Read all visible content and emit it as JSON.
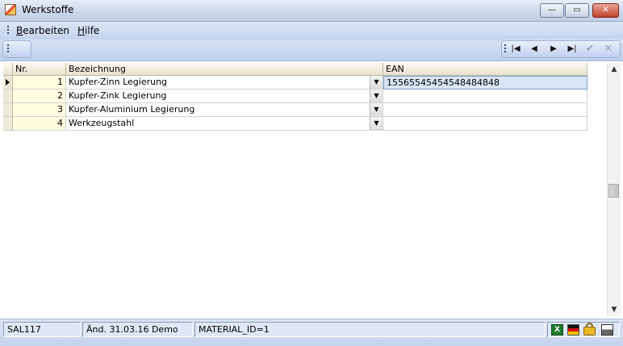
{
  "window": {
    "title": "Werkstoffe"
  },
  "titlebar_buttons": {
    "minimize": "—",
    "maximize": "▭",
    "close": "✕"
  },
  "menu": {
    "items": [
      {
        "mnemonic": "B",
        "rest": "earbeiten"
      },
      {
        "mnemonic": "H",
        "rest": "ilfe"
      }
    ]
  },
  "navigator": {
    "first": "|◀",
    "prev": "◀",
    "next": "▶",
    "last": "▶|",
    "ok": "✔",
    "cancel": "✕"
  },
  "grid": {
    "columns": [
      "Nr.",
      "Bezeichnung",
      "EAN"
    ],
    "rows": [
      {
        "nr": "1",
        "bezeichnung": "Kupfer-Zinn Legierung",
        "ean": "15565545454548484848",
        "current": true
      },
      {
        "nr": "2",
        "bezeichnung": "Kupfer-Zink Legierung",
        "ean": "",
        "current": false
      },
      {
        "nr": "3",
        "bezeichnung": "Kupfer-Aluminium Legierung",
        "ean": "",
        "current": false
      },
      {
        "nr": "4",
        "bezeichnung": "Werkzeugstahl",
        "ean": "",
        "current": false
      }
    ],
    "dropdown_glyph": "▼"
  },
  "scrollbar": {
    "up": "▲",
    "down": "▼"
  },
  "status": {
    "panel1": "SAL117",
    "panel2": "Änd. 31.03.16 Demo",
    "panel3": "MATERIAL_ID=1",
    "excel_icon_label": "X",
    "icons": [
      "excel-icon",
      "german-flag-icon",
      "lock-icon",
      "printer-icon"
    ]
  },
  "colors": {
    "titlebar": "#cdd8ea",
    "toolbar": "#c4d4ef",
    "nr_cell": "#fffde0",
    "selected_cell": "#d9e6f7"
  }
}
